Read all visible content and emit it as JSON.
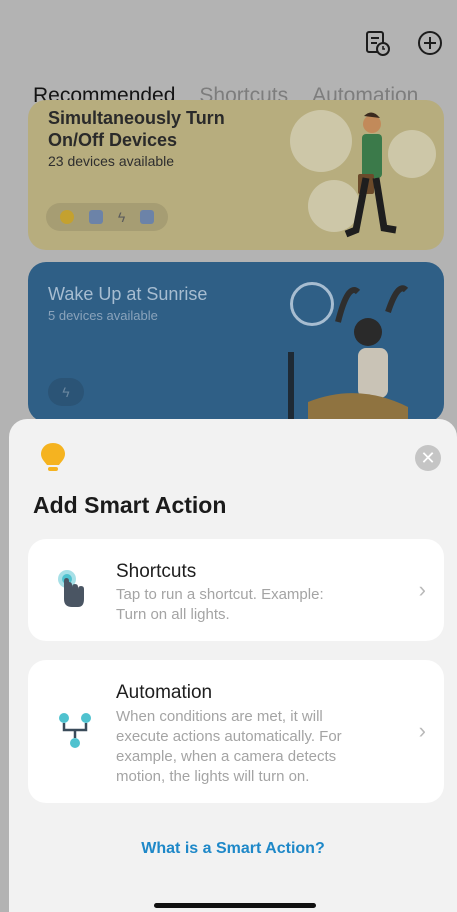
{
  "header": {
    "history_icon": "history-icon",
    "add_icon": "add-icon"
  },
  "tabs": [
    {
      "label": "Recommended",
      "active": true
    },
    {
      "label": "Shortcuts",
      "active": false
    },
    {
      "label": "Automation",
      "active": false
    }
  ],
  "cards": [
    {
      "title_line1": "Simultaneously Turn",
      "title_line2": "On/Off Devices",
      "subtitle": "23 devices available"
    },
    {
      "title": "Wake Up at Sunrise",
      "subtitle": "5 devices available"
    }
  ],
  "sheet": {
    "title": "Add Smart Action",
    "options": [
      {
        "title": "Shortcuts",
        "desc_line1": "Tap to run a shortcut. Example:",
        "desc_line2": "Turn on all lights."
      },
      {
        "title": "Automation",
        "desc_line1": "When conditions are met, it will",
        "desc_line2": "execute actions automatically. For",
        "desc_line3": "example, when a camera detects",
        "desc_line4": "motion, the lights will turn on."
      }
    ],
    "help_link": "What is a Smart Action?"
  },
  "colors": {
    "link": "#1e88c8",
    "bulb": "#f5b320",
    "teal": "#4fc2cf"
  }
}
